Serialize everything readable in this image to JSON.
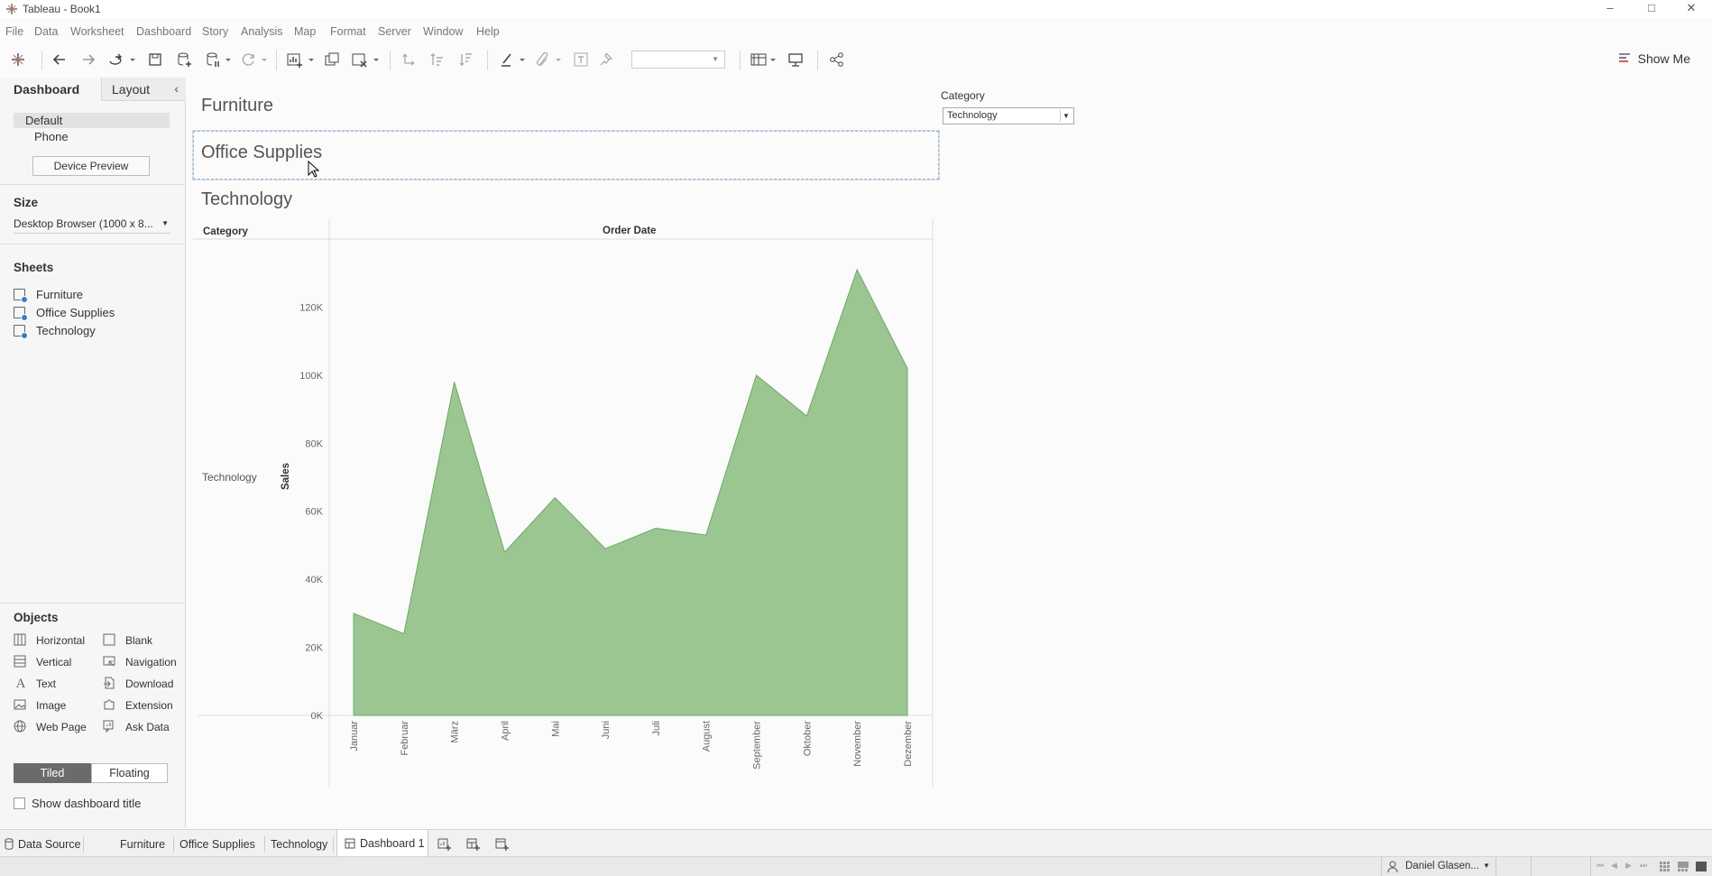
{
  "window": {
    "title": "Tableau - Book1"
  },
  "menu": [
    "File",
    "Data",
    "Worksheet",
    "Dashboard",
    "Story",
    "Analysis",
    "Map",
    "Format",
    "Server",
    "Window",
    "Help"
  ],
  "toolbar": {
    "show_me": "Show Me"
  },
  "left_panel": {
    "tabs": [
      "Dashboard",
      "Layout"
    ],
    "devices": [
      "Default",
      "Phone"
    ],
    "device_preview": "Device Preview",
    "size_heading": "Size",
    "size_value": "Desktop Browser (1000 x 8...",
    "sheets_heading": "Sheets",
    "sheets": [
      "Furniture",
      "Office Supplies",
      "Technology"
    ],
    "objects_heading": "Objects",
    "objects": [
      {
        "label": "Horizontal",
        "icon": "horizontal-icon"
      },
      {
        "label": "Blank",
        "icon": "blank-icon"
      },
      {
        "label": "Vertical",
        "icon": "vertical-icon"
      },
      {
        "label": "Navigation",
        "icon": "navigation-icon"
      },
      {
        "label": "Text",
        "icon": "text-icon"
      },
      {
        "label": "Download",
        "icon": "download-icon"
      },
      {
        "label": "Image",
        "icon": "image-icon"
      },
      {
        "label": "Extension",
        "icon": "extension-icon"
      },
      {
        "label": "Web Page",
        "icon": "web-page-icon"
      },
      {
        "label": "Ask Data",
        "icon": "ask-data-icon"
      }
    ],
    "tiled": "Tiled",
    "floating": "Floating",
    "show_title": "Show dashboard title"
  },
  "dashboard": {
    "titles": [
      "Furniture",
      "Office Supplies",
      "Technology"
    ],
    "filter_label": "Category",
    "filter_value": "Technology"
  },
  "chart_data": {
    "type": "area",
    "column_header": "Order Date",
    "row_header": "Category",
    "row_label": "Technology",
    "ylabel": "Sales",
    "ylim": [
      0,
      140000
    ],
    "y_ticks": [
      "0K",
      "20K",
      "40K",
      "60K",
      "80K",
      "100K",
      "120K"
    ],
    "y_tick_values": [
      0,
      20000,
      40000,
      60000,
      80000,
      100000,
      120000
    ],
    "categories": [
      "Januar",
      "Februar",
      "März",
      "April",
      "Mai",
      "Juni",
      "Juli",
      "August",
      "September",
      "Oktober",
      "November",
      "Dezember"
    ],
    "series": [
      {
        "values": [
          30000,
          24000,
          98000,
          48000,
          64000,
          49000,
          55000,
          53000,
          100000,
          88000,
          131000,
          102000
        ]
      }
    ],
    "color": "#9bc692",
    "stroke": "#6fa866"
  },
  "sheet_tabs": [
    "Data Source",
    "Furniture",
    "Office Supplies",
    "Technology",
    "Dashboard 1"
  ],
  "status": {
    "user": "Daniel Glasen..."
  }
}
